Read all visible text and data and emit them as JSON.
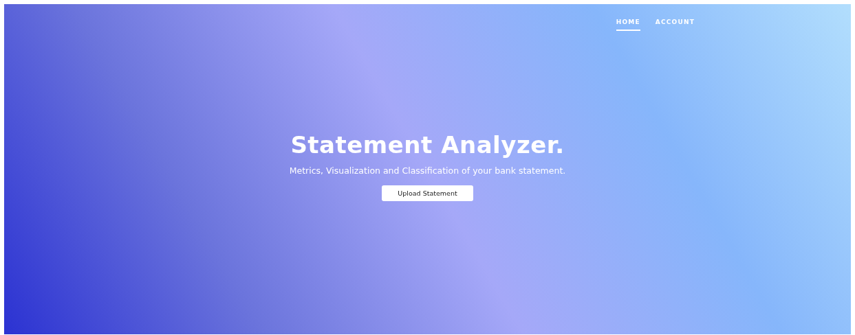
{
  "nav": {
    "items": [
      {
        "label": "HOME",
        "selected": true
      },
      {
        "label": "ACCOUNT",
        "selected": false
      }
    ]
  },
  "hero": {
    "title": "Statement Analyzer.",
    "subtitle": "Metrics, Visualization and Classification of your bank statement.",
    "button": "Upload Statement"
  }
}
